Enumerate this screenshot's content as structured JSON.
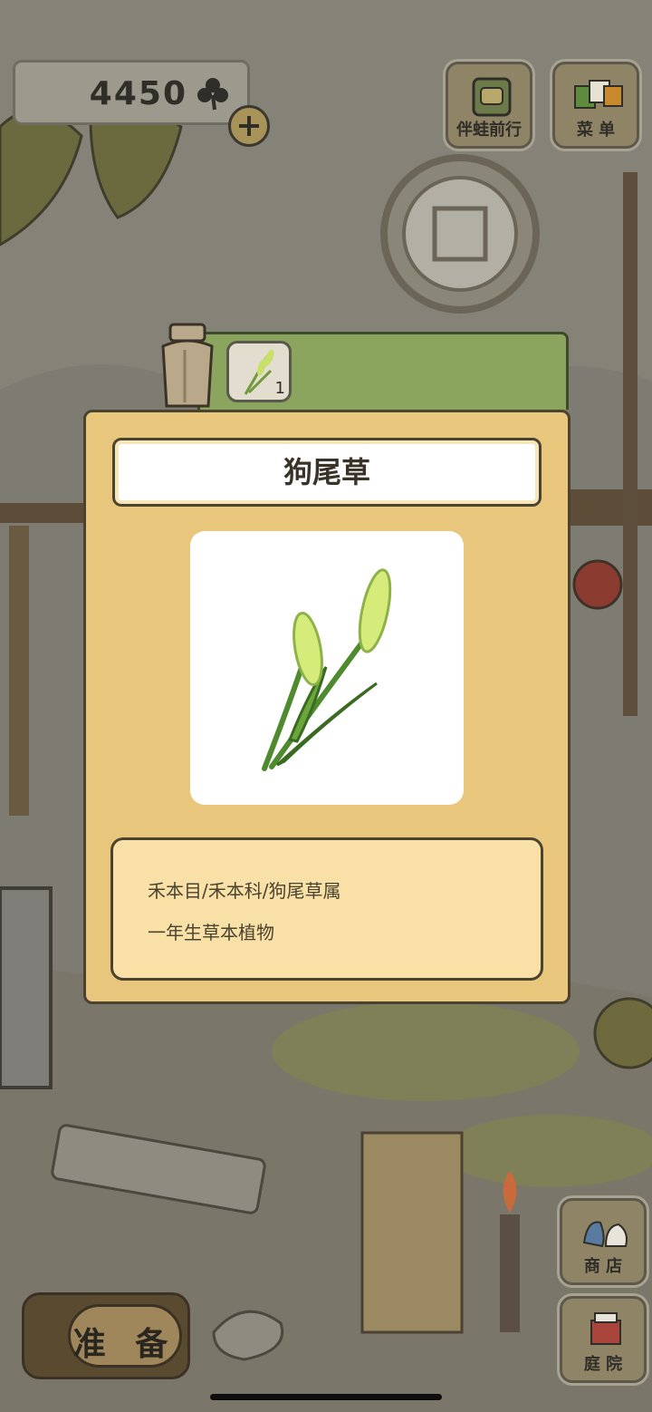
{
  "hud": {
    "clover_count": "4450",
    "top_buttons": [
      {
        "label": "伴蛙前行",
        "icon": "journey-bag-icon"
      },
      {
        "label": "菜 单",
        "icon": "menu-cards-icon"
      }
    ],
    "side_buttons": [
      {
        "label": "商 店",
        "icon": "shop-icon"
      },
      {
        "label": "庭 院",
        "icon": "garden-icon"
      }
    ],
    "prepare_label": "准 备"
  },
  "item_tab": {
    "slot_count": "1",
    "slot_icon": "foxtail-grass-icon"
  },
  "item_detail": {
    "name": "狗尾草",
    "classification": "禾本目/禾本科/狗尾草属",
    "description": "一年生草本植物",
    "image_icon": "foxtail-grass-illustration"
  }
}
